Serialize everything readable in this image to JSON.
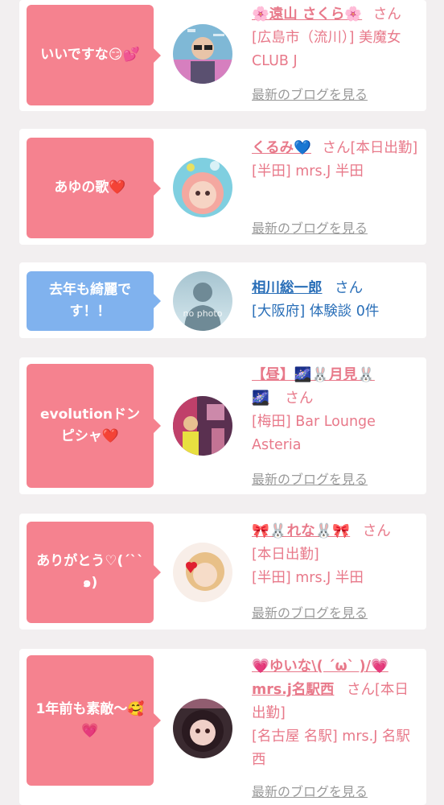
{
  "colors": {
    "pink_bubble": "#f5828f",
    "blue_bubble": "#80b2ee",
    "pink_text": "#e8798a",
    "blue_text": "#2a6fb8",
    "link_gray": "#9a9a9a"
  },
  "cards": [
    {
      "comment": "いいですな😏💕",
      "name": "🌸遠山 さくら🌸",
      "san": "さん",
      "location": "[広島市（流川）] 美魔女CLUB J",
      "blog_link": "最新のブログを見る",
      "avatar_icon": "man-sunglasses-photo"
    },
    {
      "comment": "あゆの歌❤️",
      "name": "くるみ💙",
      "san": "さん[本日出勤]",
      "location": "[半田] mrs.J 半田",
      "blog_link": "最新のブログを見る",
      "avatar_icon": "woman-photo"
    },
    {
      "comment": "去年も綺麗です！！",
      "name": "相川総一郎",
      "san": "さん",
      "location": "[大阪府] 体験談 0件",
      "blog_link": "",
      "avatar_icon": "no-photo-silhouette",
      "avatar_text": "no photo"
    },
    {
      "comment": "evolutionドンピシャ❤️",
      "name": "【昼】🌌🐰月見🐰",
      "name2": "🌌",
      "san": "さん",
      "location": "[梅田] Bar Lounge Asteria",
      "blog_link": "最新のブログを見る",
      "avatar_icon": "woman-photo"
    },
    {
      "comment": "ありがとう♡(´`` ๑)",
      "name": "🎀🐰れな🐰🎀",
      "san": "さん",
      "location_line1": "[本日出勤]",
      "location": "[半田] mrs.J 半田",
      "blog_link": "最新のブログを見る",
      "avatar_icon": "woman-photo"
    },
    {
      "comment": "1年前も素敵〜🥰💗",
      "name": "💗ゆいな\\( ´ω` )/💗mrs.j名駅西",
      "san": "さん[本日出勤]",
      "location": "[名古屋 名駅] mrs.J 名駅西",
      "blog_link": "最新のブログを見る",
      "avatar_icon": "woman-photo"
    }
  ]
}
